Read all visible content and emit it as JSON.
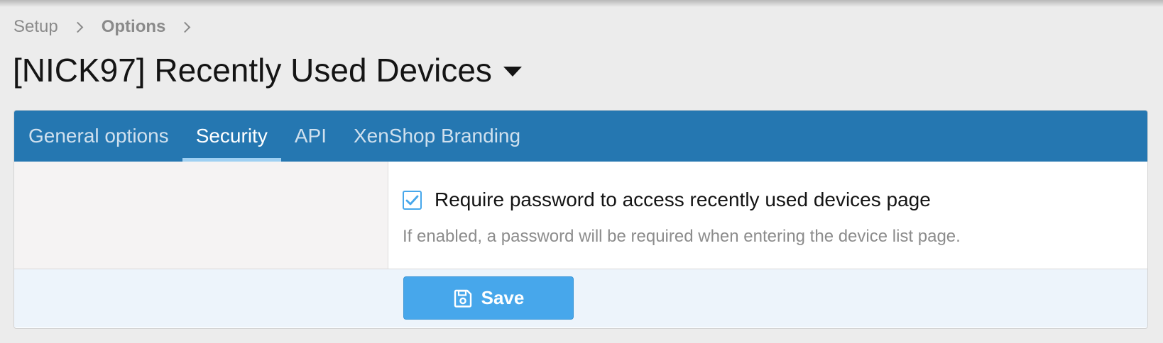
{
  "breadcrumb": {
    "items": [
      {
        "label": "Setup"
      },
      {
        "label": "Options"
      }
    ]
  },
  "page": {
    "title": "[NICK97] Recently Used Devices"
  },
  "tabs": [
    {
      "label": "General options",
      "active": false
    },
    {
      "label": "Security",
      "active": true
    },
    {
      "label": "API",
      "active": false
    },
    {
      "label": "XenShop Branding",
      "active": false
    }
  ],
  "form": {
    "require_password": {
      "label": "Require password to access recently used devices page",
      "checked": true,
      "hint": "If enabled, a password will be required when entering the device list page."
    },
    "save_label": "Save"
  },
  "colors": {
    "tabbar": "#2577b1",
    "accent": "#47a7eb",
    "submit_row": "#edf4fb"
  },
  "icons": {
    "save": "floppy-disk-icon",
    "checkbox": "check-icon",
    "title_menu": "caret-down-icon",
    "breadcrumb_separator": "chevron-right-icon"
  }
}
